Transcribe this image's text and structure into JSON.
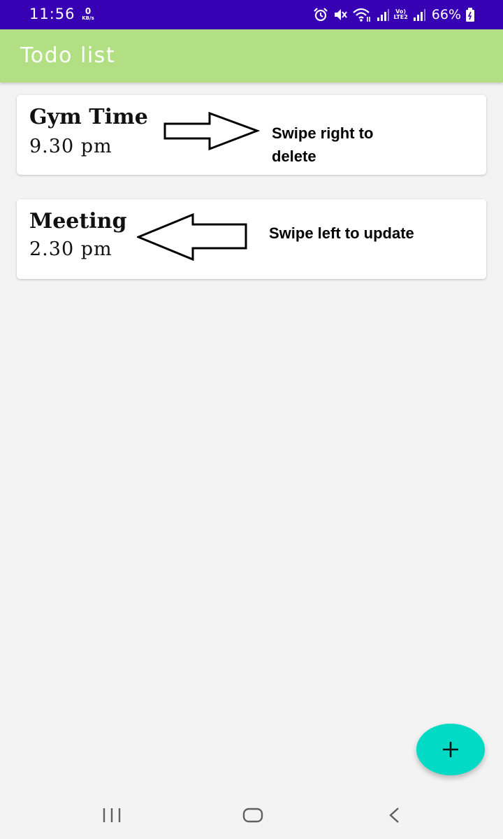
{
  "status_bar": {
    "time": "11:56",
    "net_speed_value": "0",
    "net_speed_unit": "KB/s",
    "volte_top": "Vo)",
    "volte_bottom": "LTE2",
    "battery": "66%",
    "background": "#3700b3",
    "icons": [
      "alarm-icon",
      "mute-icon",
      "wifi-icon",
      "signal-icon",
      "signal-icon",
      "battery-icon"
    ]
  },
  "app_bar": {
    "title": "Todo list",
    "background": "#b2df84"
  },
  "todos": [
    {
      "title": "Gym Time",
      "time": "9.30 pm"
    },
    {
      "title": "Meeting",
      "time": "2.30 pm"
    }
  ],
  "hints": {
    "delete_line1": "Swipe right to",
    "delete_line2": "delete",
    "update": "Swipe left to update"
  },
  "fab": {
    "icon": "plus-icon",
    "color": "#03dac5"
  },
  "nav_bar": {
    "icons": [
      "recent-apps-icon",
      "home-icon",
      "back-icon"
    ]
  }
}
